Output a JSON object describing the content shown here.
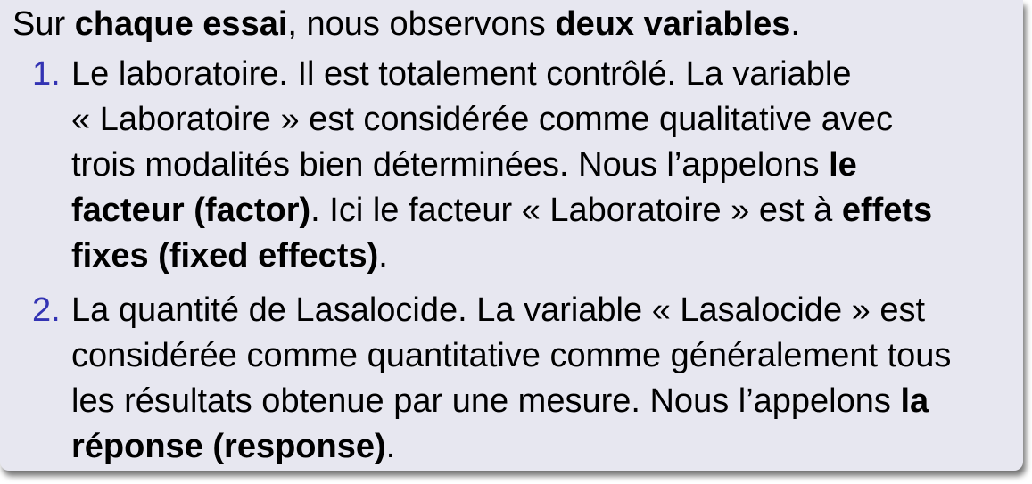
{
  "intro": {
    "t1": "Sur ",
    "b1": "chaque essai",
    "t2": ", nous observons ",
    "b2": "deux variables",
    "t3": "."
  },
  "items": [
    {
      "number": "1.",
      "l1": "Le laboratoire. Il est totalement contrôlé. La variable",
      "l2": "« Laboratoire » est considérée comme qualitative avec",
      "l3a": "trois modalités bien déterminées. Nous l’appelons ",
      "l3b": "le",
      "l4a": "facteur (factor)",
      "l4b": ". Ici le facteur « Laboratoire » est à ",
      "l4c": "effets",
      "l5a": "fixes (fixed effects)",
      "l5b": "."
    },
    {
      "number": "2.",
      "l1": "La quantité de Lasalocide. La variable « Lasalocide » est",
      "l2": "considérée comme quantitative comme généralement tous",
      "l3a": "les résultats obtenue par une mesure. Nous l’appelons ",
      "l3b": "la",
      "l4a": "réponse (response)",
      "l4b": "."
    }
  ]
}
